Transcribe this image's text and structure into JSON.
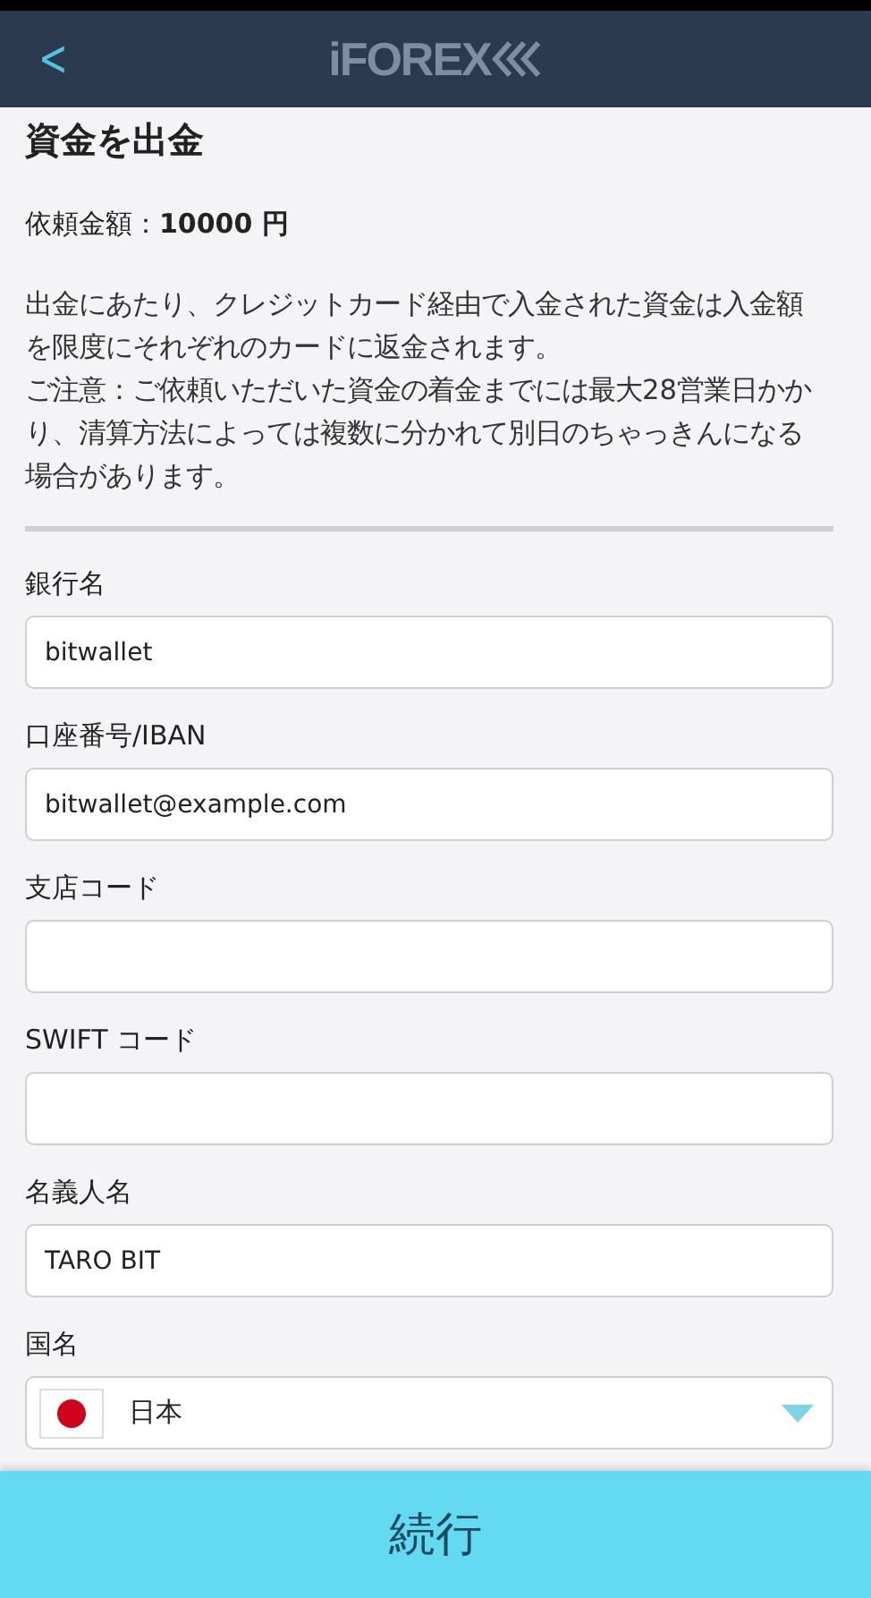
{
  "header": {
    "back_label": "<",
    "logo": "iFOREX"
  },
  "title": "資金を出金",
  "amount": "依頼金額：**10000 円**",
  "notes": [
    "出金にあたり、クレジットカード経由で入金された資金は入金額を限度にそれぞれのカードに返金されます。",
    "ご注意：ご依頼いただいた資金の着金までには最大28営業日かかり、清算方法によっては複数に分かれて別日のちゃっきんになる場合があります。"
  ],
  "fields": [
    {
      "kind": "text",
      "label": "銀行名",
      "value": "bitwallet"
    },
    {
      "kind": "text",
      "label": "口座番号/IBAN",
      "value": "bitwallet@example.com"
    },
    {
      "kind": "text",
      "label": "支店コード"
    },
    {
      "kind": "text",
      "label": "SWIFT コード"
    },
    {
      "kind": "text",
      "label": "名義人名",
      "value": "TARO BIT"
    },
    {
      "kind": "select",
      "label": "国名",
      "value": "日本"
    }
  ],
  "submit": "続行"
}
